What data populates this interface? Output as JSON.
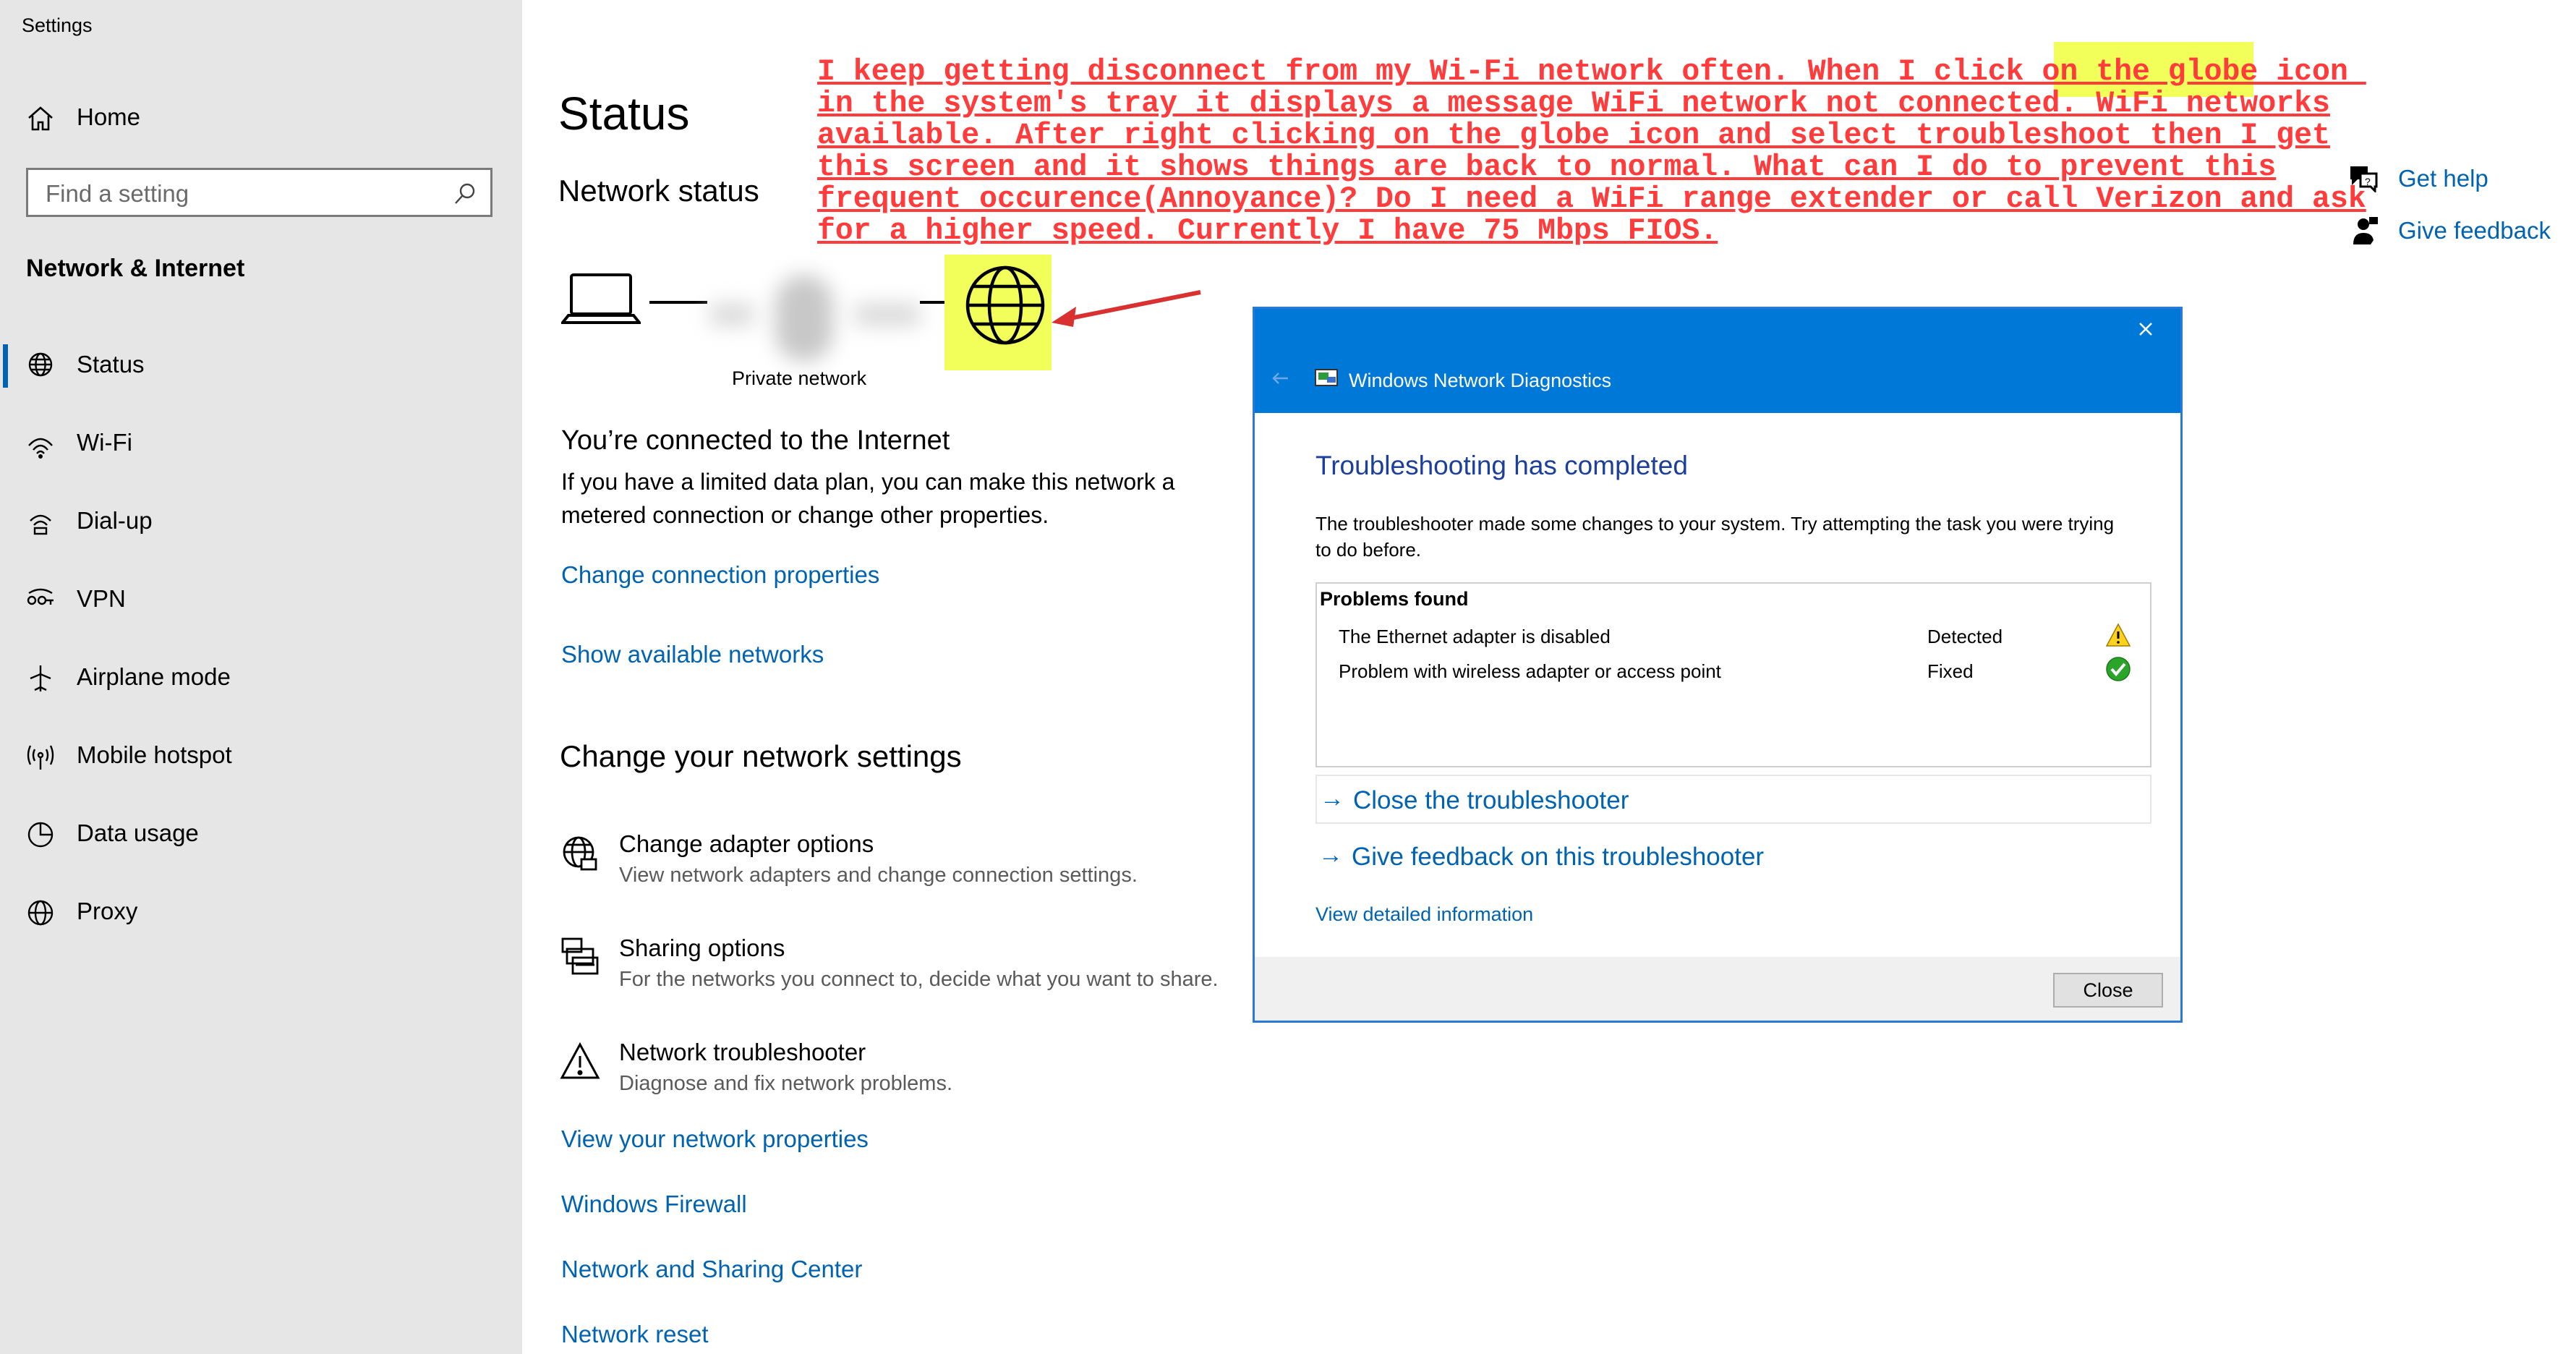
{
  "window": {
    "title": "Settings"
  },
  "sidebar": {
    "home": "Home",
    "search_placeholder": "Find a setting",
    "section": "Network & Internet",
    "items": [
      {
        "label": "Status",
        "icon": "status-globe-icon",
        "active": true
      },
      {
        "label": "Wi-Fi",
        "icon": "wifi-icon"
      },
      {
        "label": "Dial-up",
        "icon": "dialup-icon"
      },
      {
        "label": "VPN",
        "icon": "vpn-icon"
      },
      {
        "label": "Airplane mode",
        "icon": "airplane-icon"
      },
      {
        "label": "Mobile hotspot",
        "icon": "hotspot-icon"
      },
      {
        "label": "Data usage",
        "icon": "data-usage-icon"
      },
      {
        "label": "Proxy",
        "icon": "proxy-globe-icon"
      }
    ]
  },
  "main": {
    "title": "Status",
    "network_status": "Network status",
    "diagram_label": "Private network",
    "connected_title": "You’re connected to the Internet",
    "connected_desc_1": "If you have a limited data plan, you can make this network a",
    "connected_desc_2": "metered connection or change other properties.",
    "link_change_conn": "Change connection properties",
    "link_show_networks": "Show available networks",
    "settings_title": "Change your network settings",
    "options": [
      {
        "title": "Change adapter options",
        "desc": "View network adapters and change connection settings.",
        "icon": "adapter-globe-icon"
      },
      {
        "title": "Sharing options",
        "desc": "For the networks you connect to, decide what you want to share.",
        "icon": "sharing-printer-icon"
      },
      {
        "title": "Network troubleshooter",
        "desc": "Diagnose and fix network problems.",
        "icon": "warning-triangle-icon"
      }
    ],
    "links": [
      "View your network properties",
      "Windows Firewall",
      "Network and Sharing Center",
      "Network reset"
    ]
  },
  "help": {
    "get_help": "Get help",
    "give_feedback": "Give feedback"
  },
  "annotation": {
    "line1a": "I keep getting disconnect from my Wi-Fi network often. When I click on the",
    "line1b": " globe icon ",
    "line2": "in the system's tray it displays a message WiFi network not connected. WiFi networks",
    "line3": "available. After right clicking on the globe icon and select troubleshoot then I get",
    "line4": "this screen and it shows things are back to normal. What can I do to prevent this",
    "line5": "frequent occurence(Annoyance)? Do I need a WiFi range extender or call Verizon and ask",
    "line6": "for a higher speed. Currently I have 75 Mbps FIOS.",
    "color": "#ff3b3b",
    "highlight": "#f2ff5a"
  },
  "dialog": {
    "title": "Windows Network Diagnostics",
    "heading": "Troubleshooting has completed",
    "message_1": "The troubleshooter made some changes to your system. Try attempting the task you were trying",
    "message_2": "to do before.",
    "problems_header": "Problems found",
    "problems": [
      {
        "name": "The Ethernet adapter is disabled",
        "status": "Detected",
        "icon": "warning-icon"
      },
      {
        "name": "Problem with wireless adapter or access point",
        "status": "Fixed",
        "icon": "check-icon"
      }
    ],
    "action_close": "Close the troubleshooter",
    "action_feedback": "Give feedback on this troubleshooter",
    "view_details": "View detailed information",
    "close_button": "Close"
  },
  "colors": {
    "accent": "#0063b1",
    "dialog_header": "#0078d7",
    "sidebar_bg": "#e6e6e6"
  }
}
